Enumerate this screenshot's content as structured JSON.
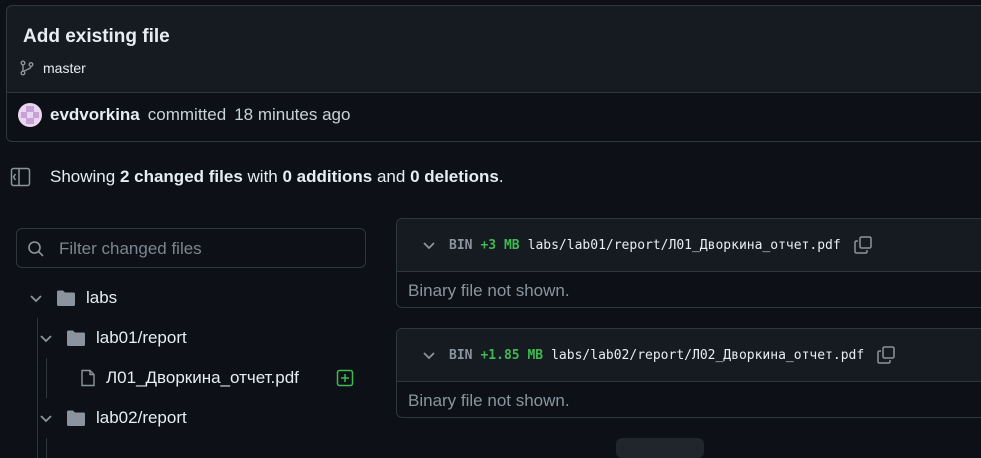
{
  "commit": {
    "title": "Add existing file",
    "branch": "master",
    "author": "evdvorkina",
    "action": "committed",
    "time": "18 minutes ago"
  },
  "summary": {
    "prefix": "Showing",
    "changed_files": "2 changed files",
    "with": "with",
    "additions": "0 additions",
    "and": "and",
    "deletions": "0 deletions",
    "end": "."
  },
  "filter": {
    "placeholder": "Filter changed files"
  },
  "tree": {
    "root": "labs",
    "dir1": "lab01/report",
    "file1": "Л01_Дворкина_отчет.pdf",
    "dir2": "lab02/report"
  },
  "files": [
    {
      "bin": "BIN",
      "size": "+3 MB",
      "path": "labs/lab01/report/Л01_Дворкина_отчет.pdf",
      "body": "Binary file not shown."
    },
    {
      "bin": "BIN",
      "size": "+1.85 MB",
      "path": "labs/lab02/report/Л02_Дворкина_отчет.pdf",
      "body": "Binary file not shown."
    }
  ],
  "colors": {
    "bg": "#0d1117",
    "panel": "#161b22",
    "border": "#30363d",
    "added": "#3fb950",
    "muted": "#8b949e"
  },
  "icons": [
    "git-branch-icon",
    "avatar",
    "sidebar-toggle-icon",
    "search-icon",
    "chevron-down-icon",
    "folder-icon",
    "file-icon",
    "diff-added-icon",
    "copy-icon"
  ]
}
